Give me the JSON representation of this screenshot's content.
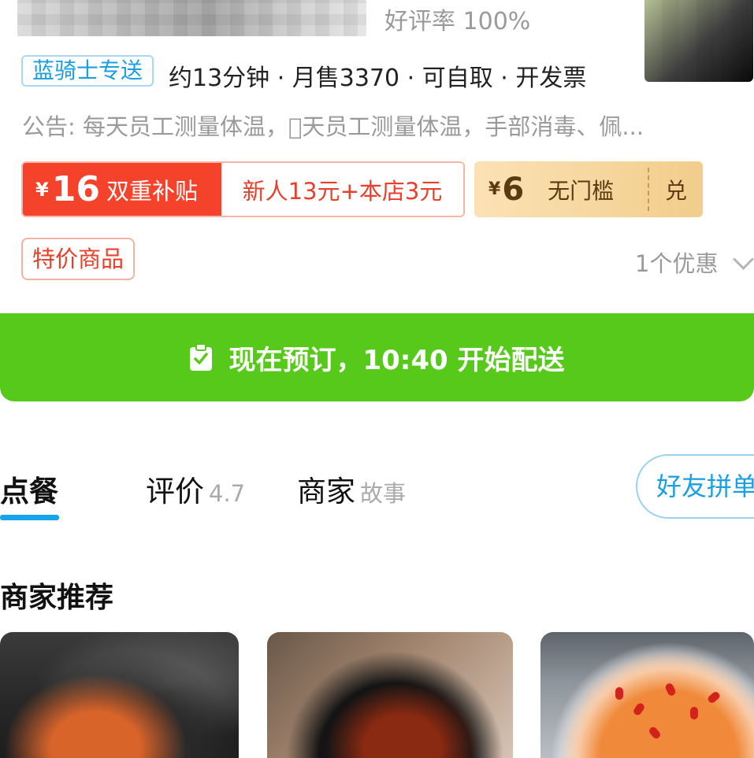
{
  "store": {
    "rating_text": "好评率 100%",
    "delivery_tag": "蓝骑士专送",
    "delivery_info": "约13分钟 · 月售3370 · 可自取 · 开发票",
    "notice": "公告: 每天员工测量体温，\u0000天员工测量体温，手部消毒、佩..."
  },
  "coupons": {
    "red": {
      "currency": "¥",
      "amount": "16",
      "label": "双重补贴",
      "detail": "新人13元+本店3元"
    },
    "gold": {
      "currency": "¥",
      "amount": "6",
      "label": "无门槛",
      "action": "兑"
    }
  },
  "promo": {
    "special_tag": "特价商品",
    "count_text": "1个优惠"
  },
  "banner": {
    "text": "现在预订，10:40 开始配送",
    "icon": "clipboard-check-icon",
    "color": "#57c91b"
  },
  "tabs": {
    "order": "点餐",
    "review": "评价",
    "review_score": "4.7",
    "merchant": "商家",
    "merchant_sub": "故事",
    "group_button": "好友拼单"
  },
  "section": {
    "title": "商家推荐"
  },
  "colors": {
    "accent_blue": "#1a9fe0",
    "red": "#f5422b",
    "gold": "#f2cd8b"
  }
}
